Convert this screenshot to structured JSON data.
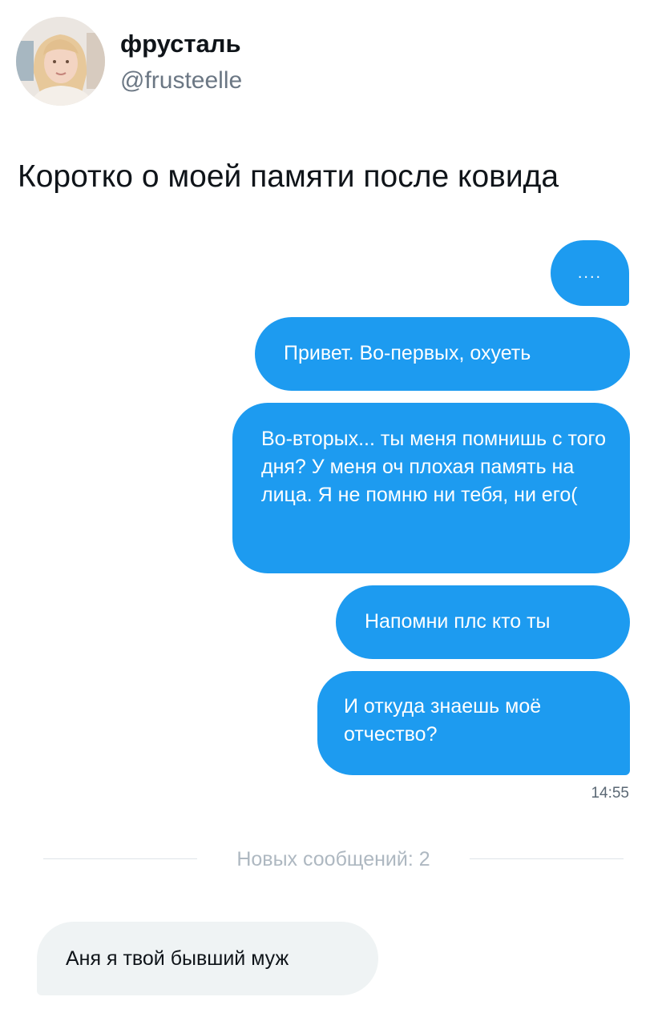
{
  "author": {
    "display_name": "фрусталь",
    "handle": "@frusteelle"
  },
  "tweet": {
    "text": "Коротко о моей памяти после ковида"
  },
  "screenshot": {
    "outgoing_messages": [
      "....",
      "Привет. Во-первых, охуеть",
      "Во-вторых... ты меня помнишь с того дня? У меня оч плохая память на лица. Я не помню ни тебя, ни его(",
      "Напомни плс кто ты",
      "И откуда знаешь моё отчество?"
    ],
    "timestamp": "14:55",
    "new_messages_label": "Новых сообщений: 2",
    "incoming_message": "Аня я твой бывший муж"
  },
  "colors": {
    "outgoing_bubble": "#1d9bf0",
    "incoming_bubble": "#eff3f4",
    "handle_text": "#6b7784"
  }
}
